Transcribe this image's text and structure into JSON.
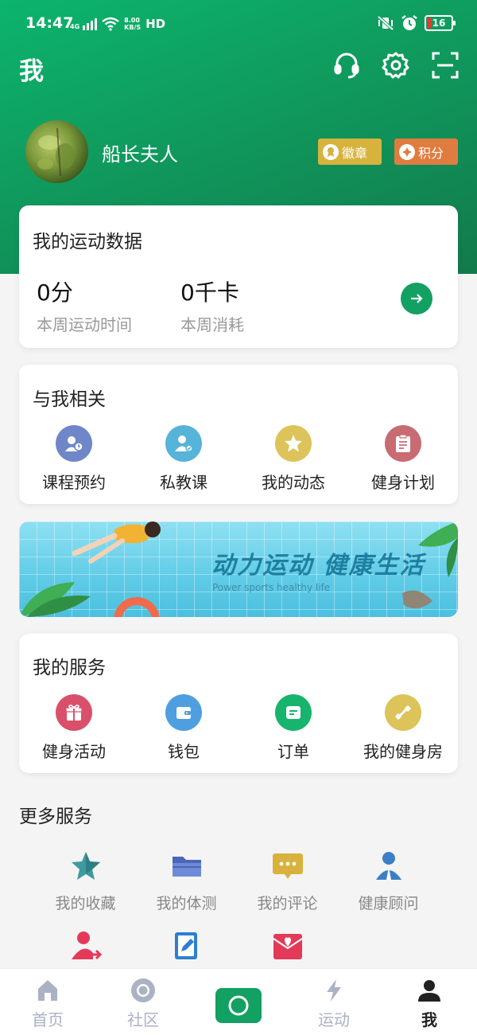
{
  "status_bar": {
    "time": "14:47",
    "net_small": "4G",
    "speed_top": "8.00",
    "speed_bottom": "KB/S",
    "hd": "HD",
    "battery": "16"
  },
  "header": {
    "title": "我",
    "icons": [
      "headset-icon",
      "settings-icon",
      "scan-icon"
    ]
  },
  "profile": {
    "name": "船长夫人",
    "badge_label": "徽章",
    "points_label": "积分"
  },
  "sport_data": {
    "title": "我的运动数据",
    "time_value": "0分",
    "time_label": "本周运动时间",
    "calorie_value": "0千卡",
    "calorie_label": "本周消耗"
  },
  "related": {
    "title": "与我相关",
    "items": [
      {
        "label": "课程预约",
        "color": "#6f87c9",
        "icon": "course-booking-icon"
      },
      {
        "label": "私教课",
        "color": "#56b3d9",
        "icon": "private-coach-icon"
      },
      {
        "label": "我的动态",
        "color": "#dcc35a",
        "icon": "star-icon"
      },
      {
        "label": "健身计划",
        "color": "#c96b72",
        "icon": "plan-icon"
      }
    ]
  },
  "banner": {
    "title": "动力运动 健康生活",
    "subtitle": "Power sports healthy life"
  },
  "services": {
    "title": "我的服务",
    "items": [
      {
        "label": "健身活动",
        "color": "#d9506a",
        "icon": "gift-icon"
      },
      {
        "label": "钱包",
        "color": "#4f9fe0",
        "icon": "wallet-icon"
      },
      {
        "label": "订单",
        "color": "#17b46e",
        "icon": "order-icon"
      },
      {
        "label": "我的健身房",
        "color": "#dcc35a",
        "icon": "gym-icon"
      }
    ]
  },
  "more": {
    "title": "更多服务",
    "items": [
      {
        "label": "我的收藏",
        "icon": "favorite-icon"
      },
      {
        "label": "我的体测",
        "icon": "folder-icon"
      },
      {
        "label": "我的评论",
        "icon": "comment-icon"
      },
      {
        "label": "健康顾问",
        "icon": "advisor-icon"
      },
      {
        "label": "",
        "icon": "user-share-icon"
      },
      {
        "label": "",
        "icon": "edit-icon"
      },
      {
        "label": "",
        "icon": "mail-heart-icon"
      }
    ]
  },
  "tabbar": {
    "items": [
      {
        "label": "首页",
        "icon": "home-icon"
      },
      {
        "label": "社区",
        "icon": "community-icon"
      },
      {
        "label": "",
        "icon": "record-icon"
      },
      {
        "label": "运动",
        "icon": "lightning-icon"
      },
      {
        "label": "我",
        "icon": "profile-icon"
      }
    ],
    "active_index": 4
  }
}
